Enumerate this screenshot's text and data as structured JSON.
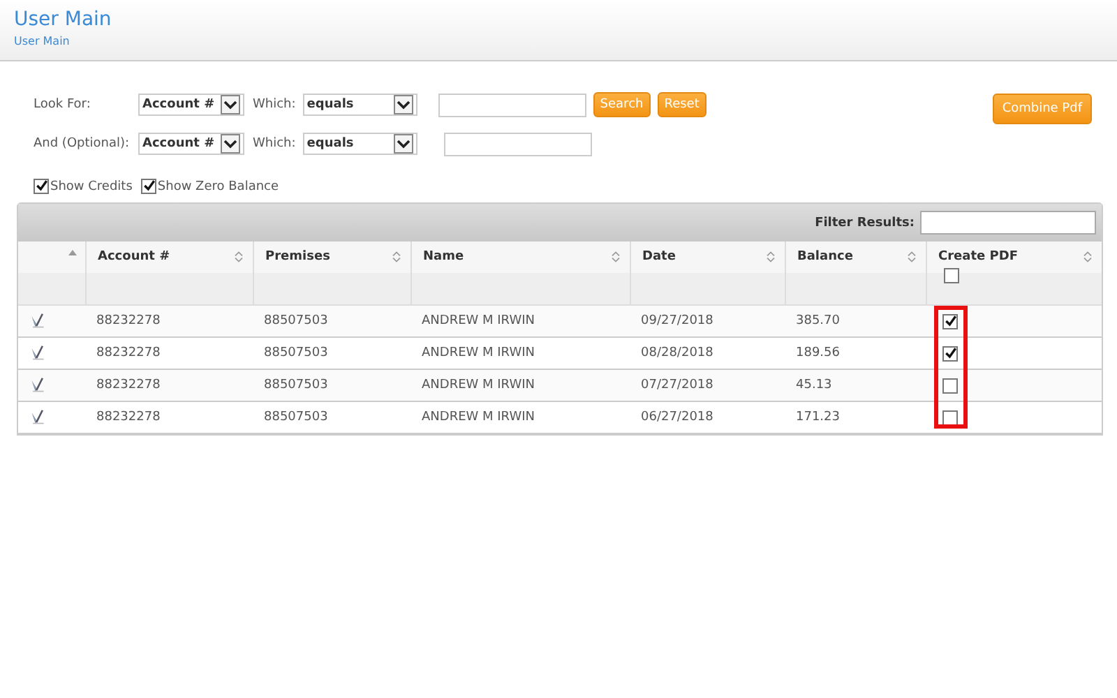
{
  "header": {
    "title": "User Main",
    "breadcrumb": "User Main"
  },
  "search": {
    "rows": [
      {
        "label": "Look For:",
        "field": "Account #",
        "which_label": "Which:",
        "operator": "equals"
      },
      {
        "label": "And (Optional):",
        "field": "Account #",
        "which_label": "Which:",
        "operator": "equals"
      }
    ],
    "buttons": [
      "Search",
      "Reset"
    ],
    "combine_button": "Combine Pdf"
  },
  "options": [
    {
      "label": "Show Credits",
      "checked": true
    },
    {
      "label": "Show Zero Balance",
      "checked": true
    }
  ],
  "table": {
    "filter_label": "Filter Results:",
    "columns": [
      "Account #",
      "Premises",
      "Name",
      "Date",
      "Balance",
      "Create PDF"
    ],
    "select_all_checked": false,
    "rows": [
      {
        "account": "88232278",
        "premises": "88507503",
        "name": "ANDREW M IRWIN",
        "date": "09/27/2018",
        "balance": "385.70",
        "create_pdf": true
      },
      {
        "account": "88232278",
        "premises": "88507503",
        "name": "ANDREW M IRWIN",
        "date": "08/28/2018",
        "balance": "189.56",
        "create_pdf": true
      },
      {
        "account": "88232278",
        "premises": "88507503",
        "name": "ANDREW M IRWIN",
        "date": "07/27/2018",
        "balance": "45.13",
        "create_pdf": false
      },
      {
        "account": "88232278",
        "premises": "88507503",
        "name": "ANDREW M IRWIN",
        "date": "06/27/2018",
        "balance": "171.23",
        "create_pdf": false
      }
    ]
  }
}
